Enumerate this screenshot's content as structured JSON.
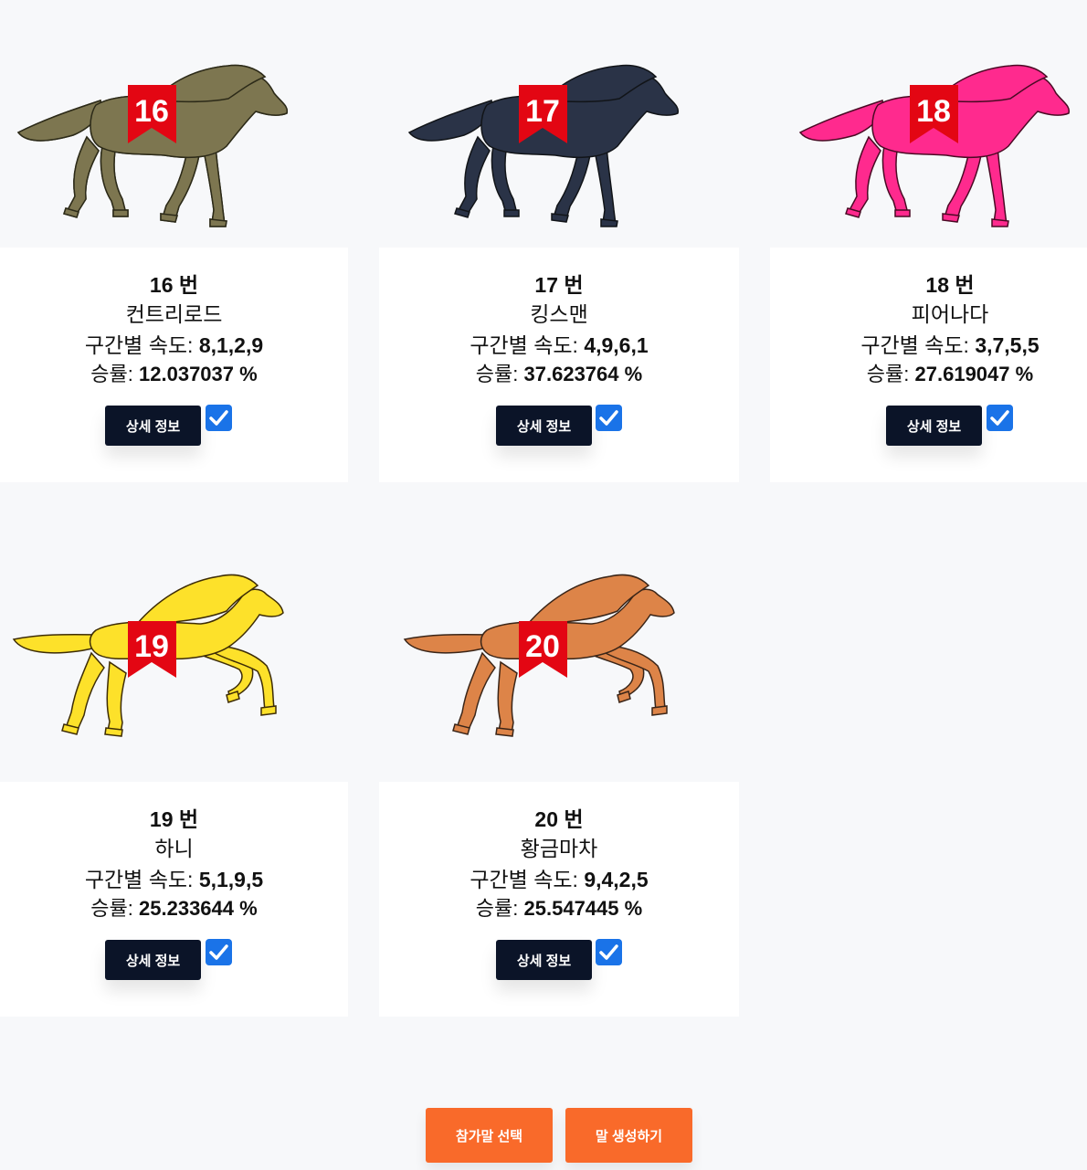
{
  "horses": [
    {
      "number_label": "16 번",
      "name": "컨트리로드",
      "speed_label": "구간별 속도:",
      "speed_value": "8,1,2,9",
      "rate_label": "승률:",
      "rate_value": "12.037037 %",
      "bib": "16",
      "detail_label": "상세 정보",
      "checked": true,
      "body_color": "#7d7650",
      "mane_color": "#2c2a18"
    },
    {
      "number_label": "17 번",
      "name": "킹스맨",
      "speed_label": "구간별 속도:",
      "speed_value": "4,9,6,1",
      "rate_label": "승률:",
      "rate_value": "37.623764 %",
      "bib": "17",
      "detail_label": "상세 정보",
      "checked": true,
      "body_color": "#2a3347",
      "mane_color": "#111418"
    },
    {
      "number_label": "18 번",
      "name": "피어나다",
      "speed_label": "구간별 속도:",
      "speed_value": "3,7,5,5",
      "rate_label": "승률:",
      "rate_value": "27.619047 %",
      "bib": "18",
      "detail_label": "상세 정보",
      "checked": true,
      "body_color": "#ff2a8e",
      "mane_color": "#4a0a24"
    },
    {
      "number_label": "19 번",
      "name": "하니",
      "speed_label": "구간별 속도:",
      "speed_value": "5,1,9,5",
      "rate_label": "승률:",
      "rate_value": "25.233644 %",
      "bib": "19",
      "detail_label": "상세 정보",
      "checked": true,
      "body_color": "#fde12a",
      "mane_color": "#3d2c06"
    },
    {
      "number_label": "20 번",
      "name": "황금마차",
      "speed_label": "구간별 속도:",
      "speed_value": "9,4,2,5",
      "rate_label": "승률:",
      "rate_value": "25.547445 %",
      "bib": "20",
      "detail_label": "상세 정보",
      "checked": true,
      "body_color": "#dd8448",
      "mane_color": "#3a2518"
    }
  ],
  "actions": {
    "select_label": "참가말 선택",
    "create_label": "말 생성하기"
  },
  "colors": {
    "bib": "#e30613",
    "button_dark": "#0b1428",
    "checkbox": "#1a73e8",
    "action": "#f96a2a"
  }
}
